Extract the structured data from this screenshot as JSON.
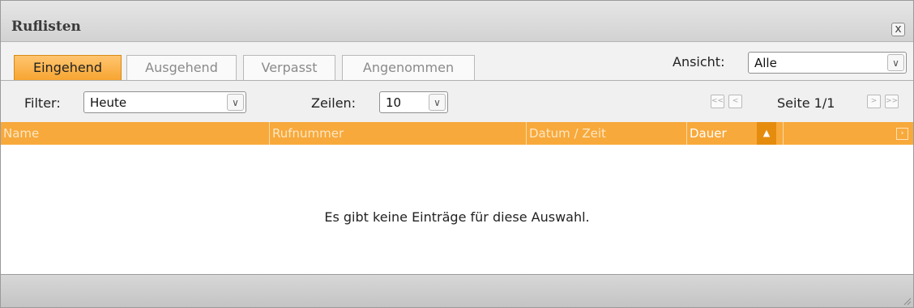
{
  "window": {
    "title": "Ruflisten",
    "close_label": "x"
  },
  "tabs": [
    {
      "label": "Eingehend",
      "active": true
    },
    {
      "label": "Ausgehend",
      "active": false
    },
    {
      "label": "Verpasst",
      "active": false
    },
    {
      "label": "Angenommen",
      "active": false
    }
  ],
  "view": {
    "label": "Ansicht:",
    "value": "Alle"
  },
  "filter": {
    "label": "Filter:",
    "value": "Heute"
  },
  "rows": {
    "label": "Zeilen:",
    "value": "10"
  },
  "pager": {
    "page_text": "Seite 1/1",
    "first": "<<",
    "prev": "<",
    "next": ">",
    "last": ">>"
  },
  "table": {
    "columns": [
      "Name",
      "Rufnummer",
      "Datum / Zeit",
      "Dauer"
    ],
    "sort_indicator": "▲",
    "menu_glyph": "›",
    "empty_message": "Es gibt keine Einträge für diese Auswahl."
  },
  "colors": {
    "accent": "#f8a93b",
    "accent_dark": "#e58c0f"
  }
}
